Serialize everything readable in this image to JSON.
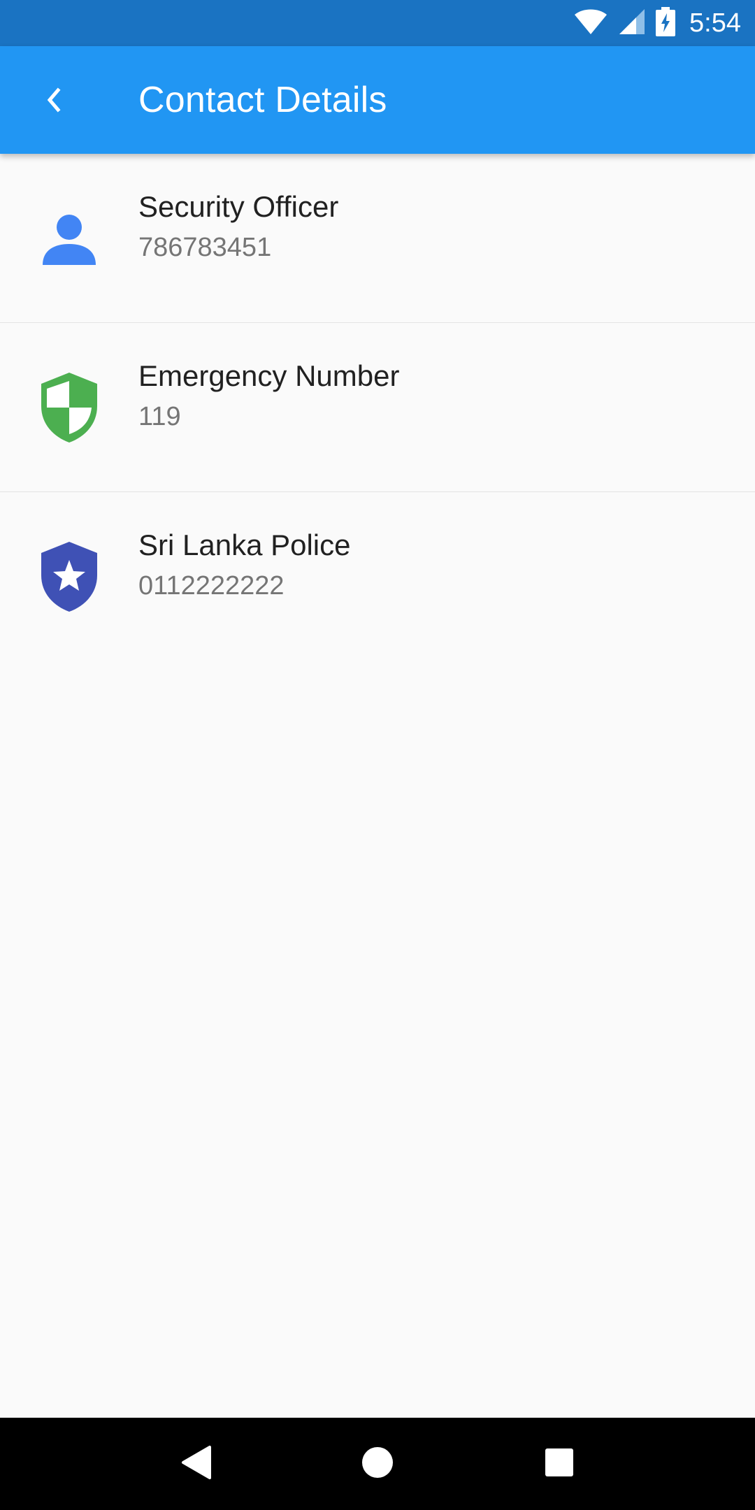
{
  "status_bar": {
    "time": "5:54",
    "icons": [
      "wifi-icon",
      "signal-icon",
      "battery-charging-icon"
    ]
  },
  "app_bar": {
    "back_icon": "chevron-left-icon",
    "title": "Contact Details"
  },
  "contacts": [
    {
      "name": "Security Officer",
      "number": "786783451",
      "icon": "person-icon",
      "icon_color": "#4285f4"
    },
    {
      "name": "Emergency Number",
      "number": "119",
      "icon": "shield-check-icon",
      "icon_color": "#4caf50"
    },
    {
      "name": "Sri Lanka Police",
      "number": "0112222222",
      "icon": "police-badge-icon",
      "icon_color": "#3f51b5"
    }
  ],
  "colors": {
    "status_bar": "#1a73c2",
    "app_bar": "#2196f3",
    "background": "#fafafa"
  },
  "nav_bar": {
    "icons": [
      "nav-back-icon",
      "nav-home-icon",
      "nav-recents-icon"
    ]
  }
}
